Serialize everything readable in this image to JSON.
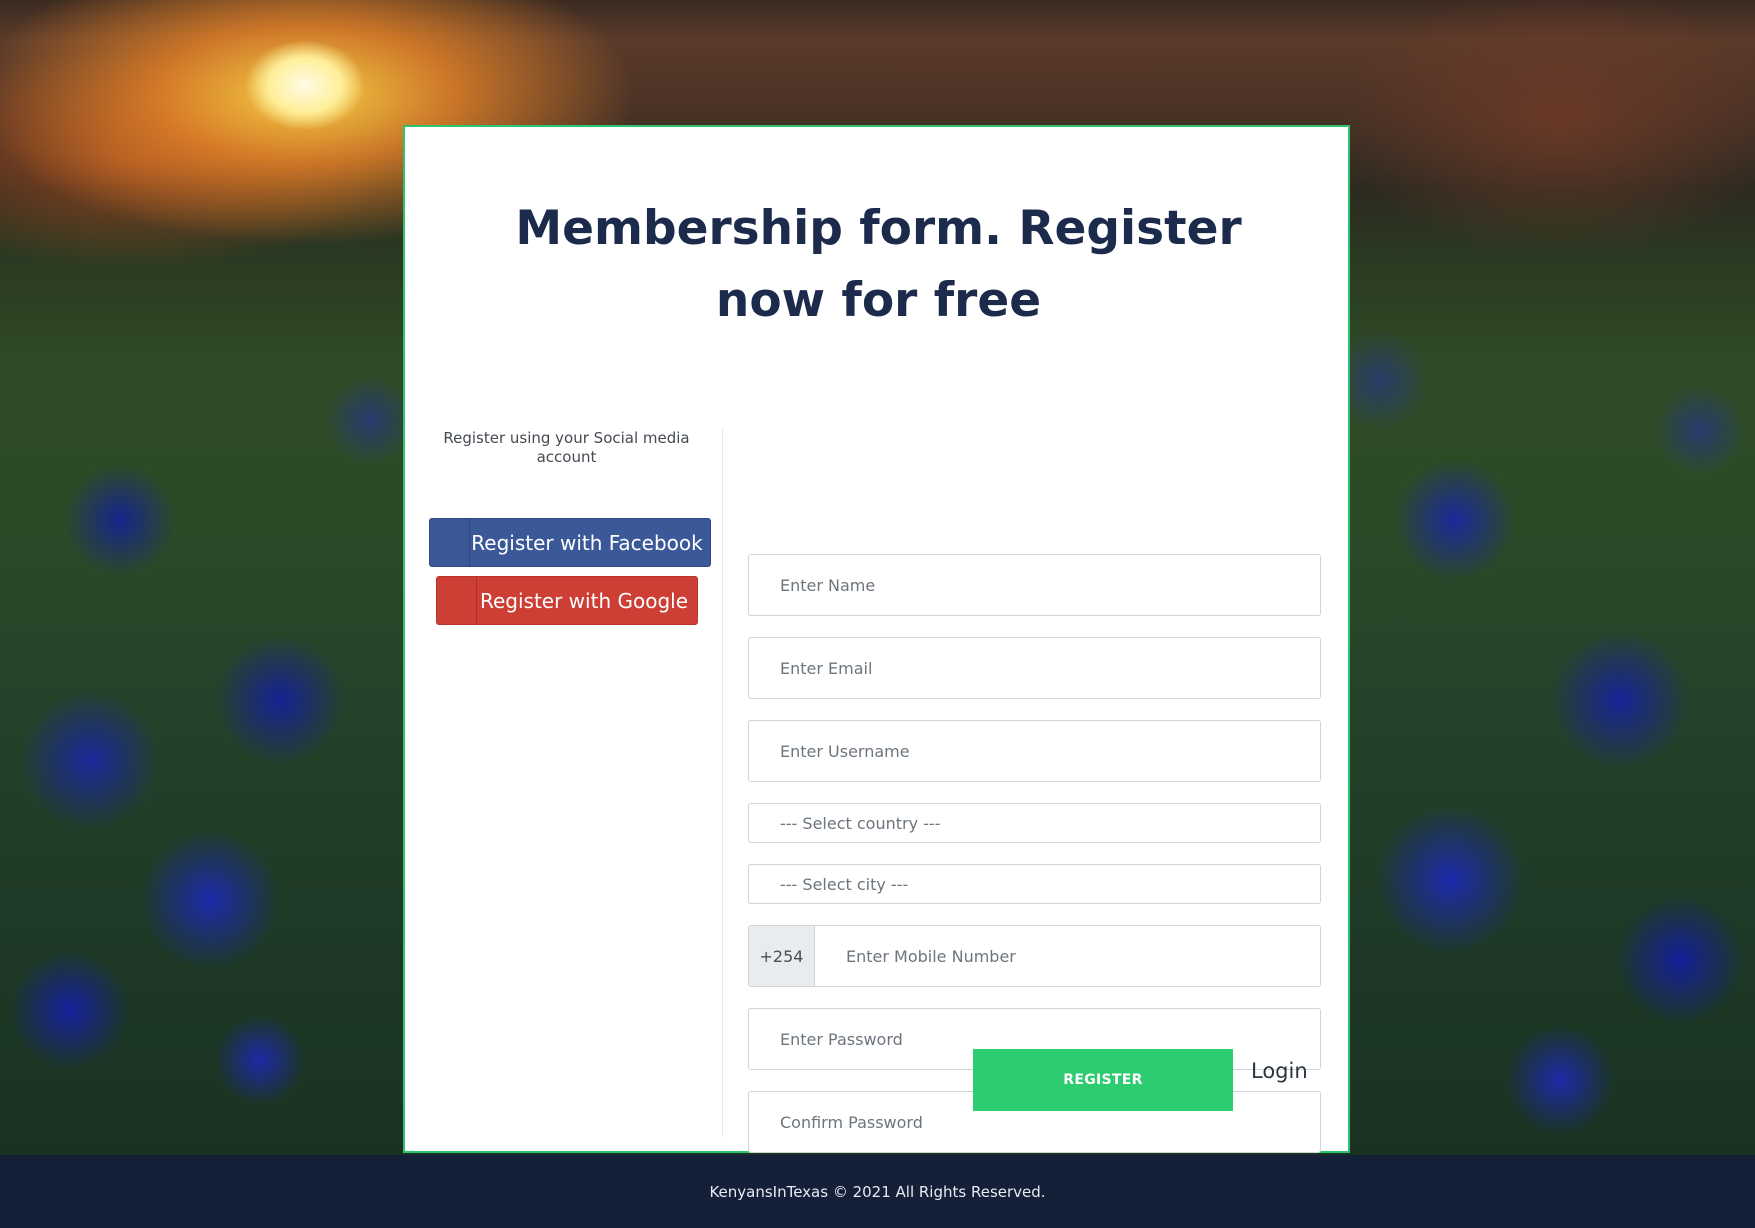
{
  "form": {
    "title": "Membership form. Register now for free",
    "social": {
      "caption": "Register using your Social media account",
      "facebook_label": "Register with Facebook",
      "google_label": "Register with Google"
    },
    "fields": {
      "name_placeholder": "Enter Name",
      "email_placeholder": "Enter Email",
      "username_placeholder": "Enter Username",
      "country_selected": "--- Select country ---",
      "city_selected": "--- Select city ---",
      "phone_prefix": "+254",
      "mobile_placeholder": "Enter Mobile Number",
      "password_placeholder": "Enter Password",
      "confirm_password_placeholder": "Confirm Password"
    },
    "register_label": "REGISTER",
    "login_label": "Login"
  },
  "footer": {
    "text": "KenyansInTexas © 2021 All Rights Reserved."
  },
  "colors": {
    "accent_green": "#2ecc71",
    "facebook_blue": "#3b5998",
    "google_red": "#cd3e35",
    "title_navy": "#1c2b4b",
    "footer_navy": "#141f38"
  },
  "background": {
    "icon": "bluebonnet-field-sunset-image"
  }
}
